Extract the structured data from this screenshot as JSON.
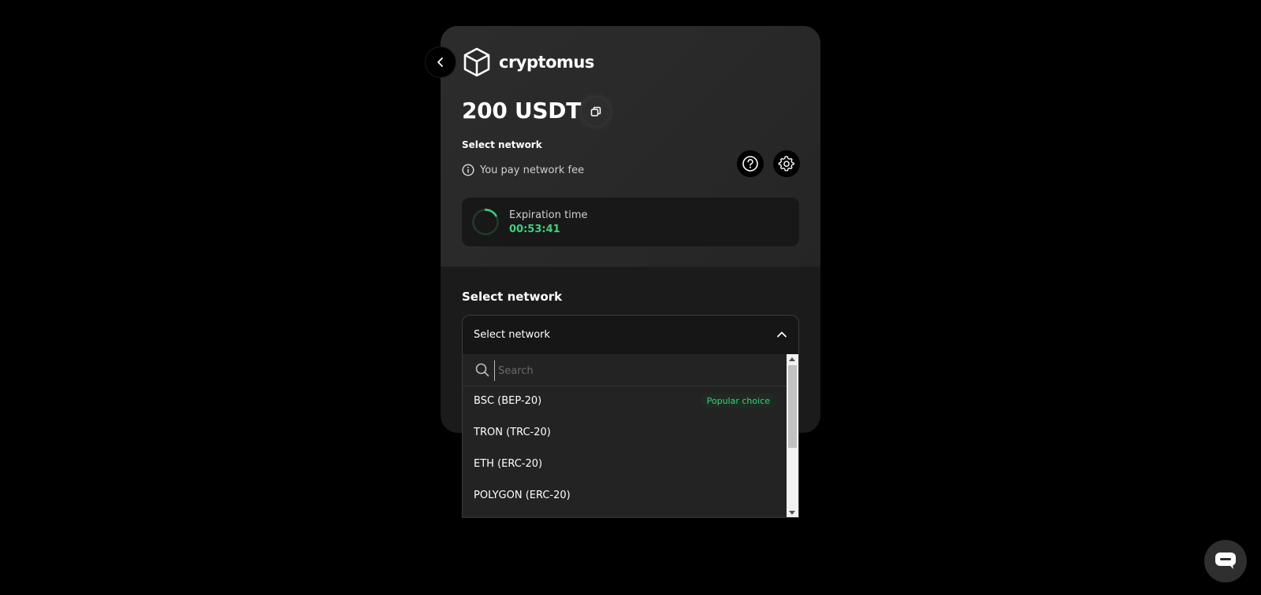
{
  "brand": {
    "name": "cryptomus"
  },
  "payment": {
    "amount": "200 USDT",
    "select_network_label": "Select network",
    "fee_note": "You pay network fee",
    "expiration": {
      "label": "Expiration time",
      "time": "00:53:41"
    }
  },
  "network_section": {
    "title": "Select network",
    "dropdown": {
      "selected": "Select network",
      "search_placeholder": "Search",
      "options": [
        {
          "label": "BSC (BEP-20)",
          "badge": "Popular choice"
        },
        {
          "label": "TRON (TRC-20)"
        },
        {
          "label": "ETH (ERC-20)"
        },
        {
          "label": "POLYGON (ERC-20)"
        }
      ]
    }
  },
  "colors": {
    "accent_green": "#3bd27b",
    "card_bg": "#1b1b1b",
    "page_bg": "#000000"
  },
  "icons": [
    "chevron-left-icon",
    "cube-logo-icon",
    "copy-icon",
    "info-icon",
    "help-icon",
    "gear-icon",
    "spinner-icon",
    "search-icon",
    "chevron-up-icon",
    "chat-icon"
  ]
}
